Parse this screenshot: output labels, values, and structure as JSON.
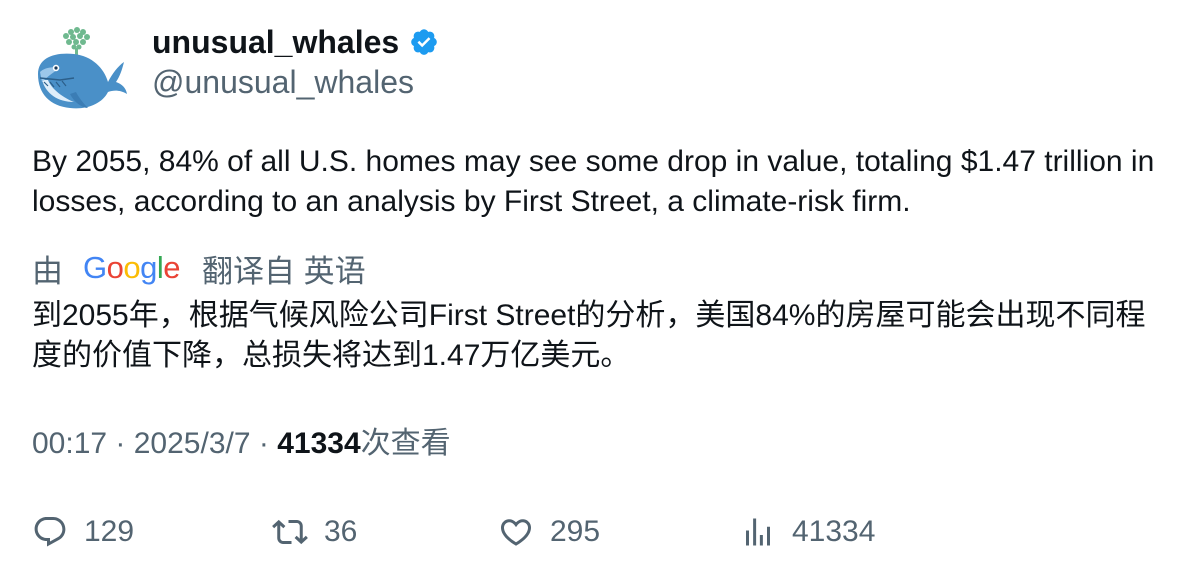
{
  "author": {
    "display_name": "unusual_whales",
    "handle": "@unusual_whales",
    "verified": true,
    "avatar_icon": "whale-icon"
  },
  "tweet": {
    "text": "By 2055, 84% of all U.S. homes may see some drop in value, totaling $1.47 trillion in losses, according to an analysis by First Street, a climate-risk firm."
  },
  "translation": {
    "prefix": "由",
    "provider": "Google",
    "suffix": "翻译自 英语",
    "text": "到2055年，根据气候风险公司First Street的分析，美国84%的房屋可能会出现不同程度的价值下降，总损失将达到1.47万亿美元。"
  },
  "meta": {
    "time": "00:17",
    "separator": "·",
    "date": "2025/3/7",
    "views_count": "41334",
    "views_label": "次查看"
  },
  "actions": {
    "replies": "129",
    "retweets": "36",
    "likes": "295",
    "views": "41334"
  },
  "colors": {
    "text": "#0f1419",
    "secondary": "#536471",
    "verified": "#1d9bf0"
  }
}
